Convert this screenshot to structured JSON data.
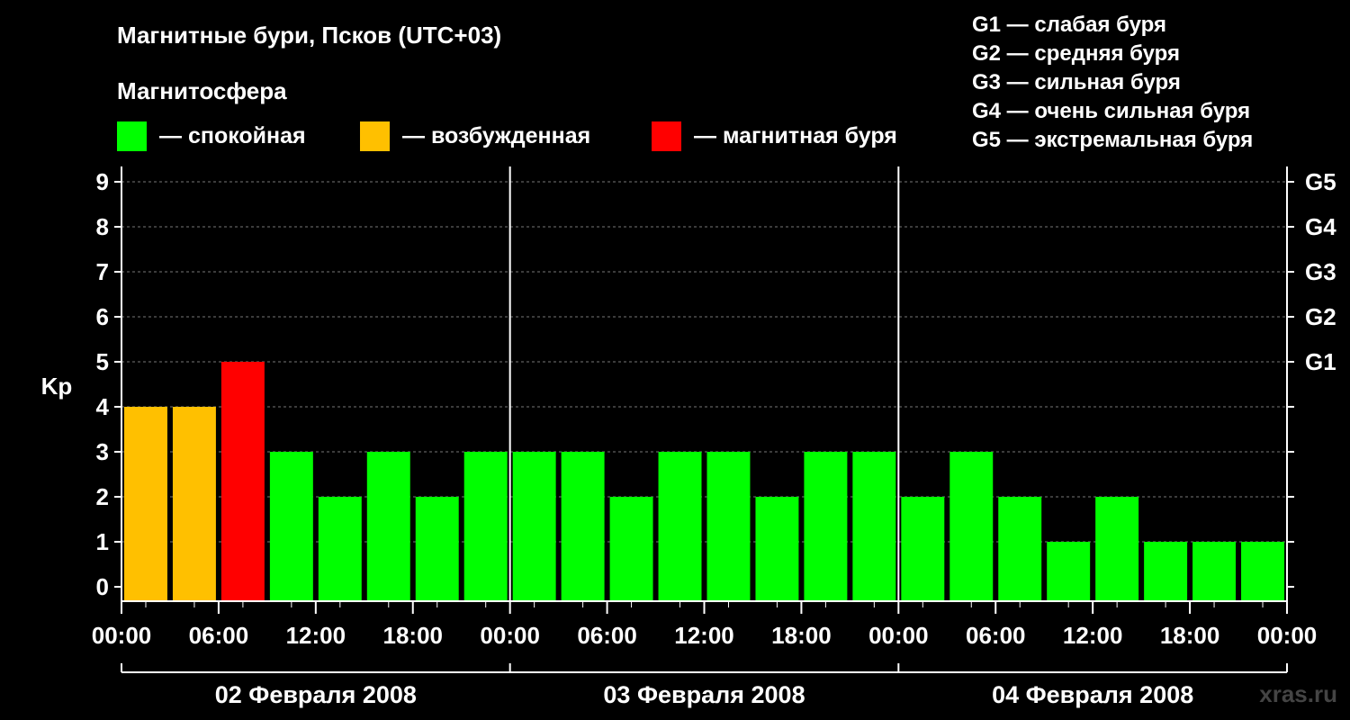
{
  "title": "Магнитные бури, Псков (UTC+03)",
  "subtitle": "Магнитосфера",
  "legend": [
    {
      "label": "— спокойная",
      "color": "#00ff00"
    },
    {
      "label": "— возбужденная",
      "color": "#ffc000"
    },
    {
      "label": "— магнитная буря",
      "color": "#ff0000"
    }
  ],
  "g_legend": [
    "G1 — слабая буря",
    "G2 — средняя буря",
    "G3 — сильная буря",
    "G4 — очень сильная буря",
    "G5 — экстремальная буря"
  ],
  "watermark": "xras.ru",
  "chart_data": {
    "type": "bar",
    "ylabel": "Kp",
    "ylim": [
      0,
      9
    ],
    "y_ticks": [
      "0",
      "1",
      "2",
      "3",
      "4",
      "5",
      "6",
      "7",
      "8",
      "9"
    ],
    "right_ticks": [
      {
        "value": 5,
        "label": "G1"
      },
      {
        "value": 6,
        "label": "G2"
      },
      {
        "value": 7,
        "label": "G3"
      },
      {
        "value": 8,
        "label": "G4"
      },
      {
        "value": 9,
        "label": "G5"
      }
    ],
    "grid": true,
    "x_tick_labels": [
      "00:00",
      "06:00",
      "12:00",
      "18:00",
      "00:00",
      "06:00",
      "12:00",
      "18:00",
      "00:00",
      "06:00",
      "12:00",
      "18:00",
      "00:00"
    ],
    "days": [
      "02 Февраля 2008",
      "03 Февраля 2008",
      "04 Февраля 2008"
    ],
    "interval_hours": 3,
    "values": [
      4,
      4,
      5,
      3,
      2,
      3,
      2,
      3,
      3,
      3,
      2,
      3,
      3,
      2,
      3,
      3,
      2,
      3,
      2,
      1,
      2,
      1,
      1,
      1
    ],
    "colors": {
      "quiet": "#00ff00",
      "active": "#ffc000",
      "storm": "#ff0000"
    }
  }
}
